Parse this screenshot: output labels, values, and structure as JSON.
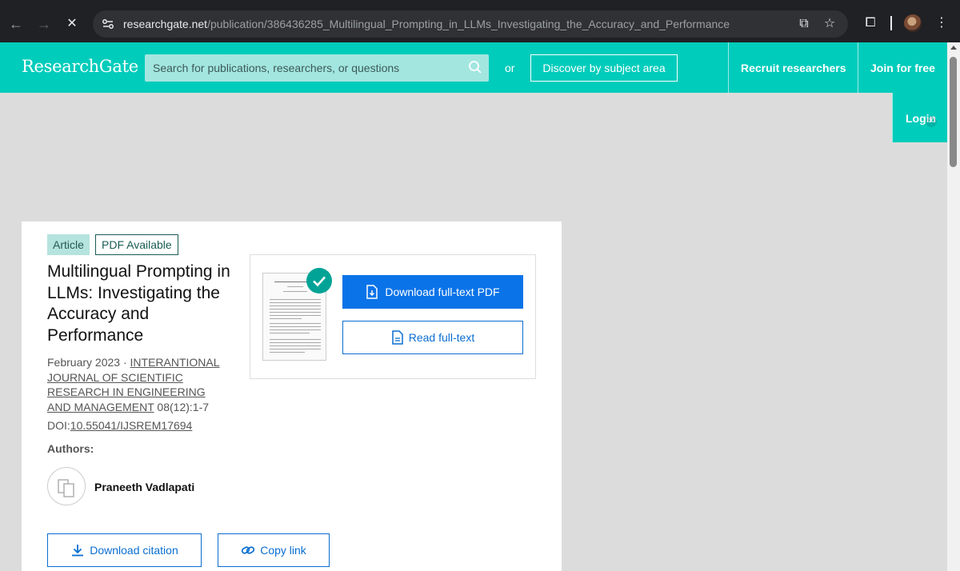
{
  "browser": {
    "url_host": "researchgate.net",
    "url_path": "/publication/386436285_Multilingual_Prompting_in_LLMs_Investigating_the_Accuracy_and_Performance"
  },
  "header": {
    "logo": "ResearchGate",
    "search_placeholder": "Search for publications, researchers, or questions",
    "or_label": "or",
    "discover_label": "Discover by subject area",
    "recruit_label": "Recruit researchers",
    "join_label": "Join for free",
    "login_label": "Login"
  },
  "publication": {
    "type_badge": "Article",
    "pdf_badge": "PDF Available",
    "title": "Multilingual Prompting in LLMs: Investigating the Accuracy and Performance",
    "date": "February 2023",
    "separator": " · ",
    "journal": "INTERANTIONAL JOURNAL OF SCIENTIFIC RESEARCH IN ENGINEERING AND MANAGEMENT",
    "issue": " 08(12):1-7",
    "doi_label": "DOI:",
    "doi": "10.55041/IJSREM17694",
    "authors_label": "Authors:",
    "author_name": "Praneeth Vadlapati"
  },
  "actions": {
    "download_pdf": "Download full-text PDF",
    "read_full_text": "Read full-text",
    "download_citation": "Download citation",
    "copy_link": "Copy link"
  },
  "colors": {
    "brand": "#00ccbb",
    "primary": "#0a73e8",
    "link": "#0a6ed1",
    "check": "#00a395"
  }
}
